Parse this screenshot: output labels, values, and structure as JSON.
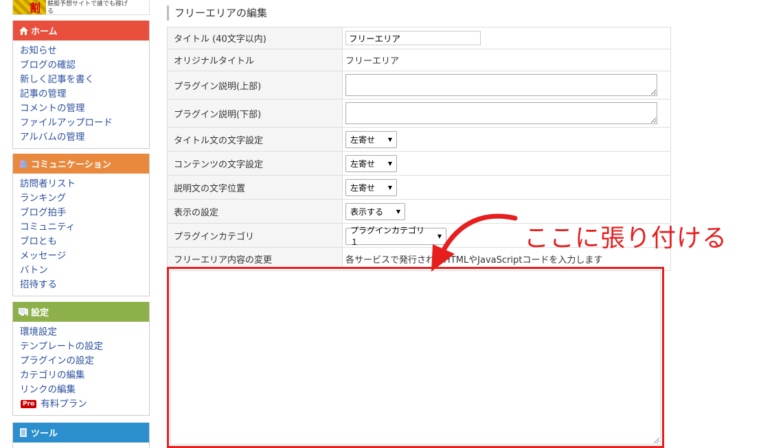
{
  "ad": {
    "logo_char": "割",
    "text": "競艇予想サイトで誰でも稼げ",
    "text2": "る"
  },
  "sidebar": {
    "home": {
      "title": "ホーム",
      "color": "#e8503d",
      "items": [
        "お知らせ",
        "ブログの確認",
        "新しく記事を書く",
        "記事の管理",
        "コメントの管理",
        "ファイルアップロード",
        "アルバムの管理"
      ]
    },
    "communication": {
      "title": "コミュニケーション",
      "color": "#e8893e",
      "items": [
        "訪問者リスト",
        "ランキング",
        "ブログ拍手",
        "コミュニティ",
        "ブロとも",
        "メッセージ",
        "バトン",
        "招待する"
      ]
    },
    "settings": {
      "title": "設定",
      "color": "#8eb04a",
      "items": [
        "環境設定",
        "テンプレートの設定",
        "プラグインの設定",
        "カテゴリの編集",
        "リンクの編集"
      ],
      "pro_badge": "Pro",
      "pro_label": "有料プラン"
    },
    "tools": {
      "title": "ツール",
      "color": "#2a8fcc"
    }
  },
  "main": {
    "title": "フリーエリアの編集",
    "rows": {
      "title_label": "タイトル (40文字以内)",
      "title_value": "フリーエリア",
      "original_label": "オリジナルタイトル",
      "original_value": "フリーエリア",
      "desc_top_label": "プラグイン説明(上部)",
      "desc_bottom_label": "プラグイン説明(下部)",
      "title_align_label": "タイトル文の文字設定",
      "title_align_value": "左寄せ",
      "content_align_label": "コンテンツの文字設定",
      "content_align_value": "左寄せ",
      "desc_align_label": "説明文の文字位置",
      "desc_align_value": "左寄せ",
      "display_label": "表示の設定",
      "display_value": "表示する",
      "category_label": "プラグインカテゴリ",
      "category_value": "プラグインカテゴリ１",
      "content_label": "フリーエリア内容の変更",
      "content_hint": "各サービスで発行されたHTMLやJavaScriptコードを入力します"
    }
  },
  "annotation": {
    "text": "ここに張り付ける",
    "color": "#e61e1e"
  }
}
